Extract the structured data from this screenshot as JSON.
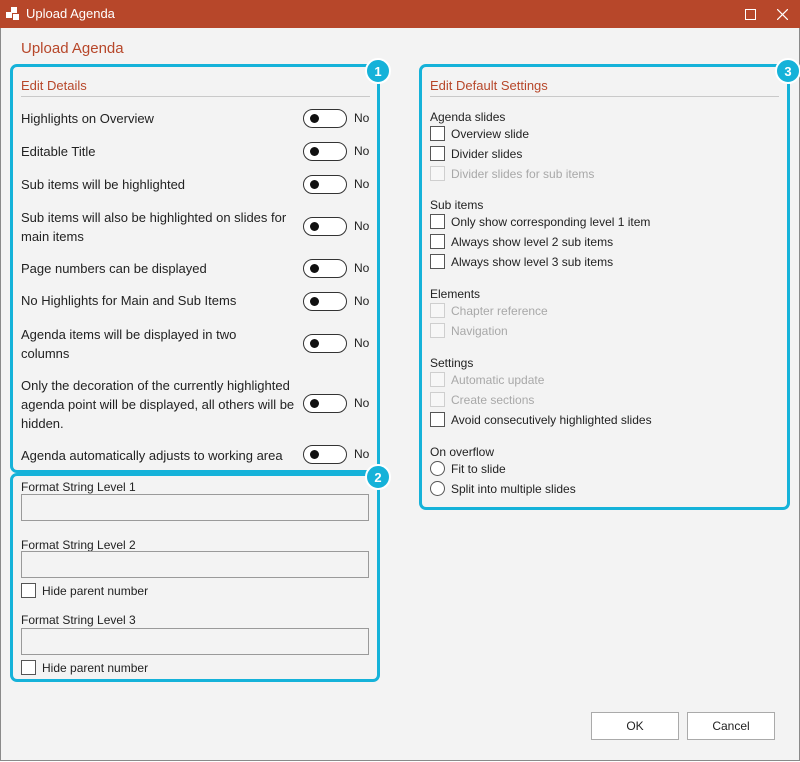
{
  "window": {
    "title": "Upload Agenda"
  },
  "dialog_title": "Upload Agenda",
  "badges": [
    "1",
    "2",
    "3"
  ],
  "colors": {
    "accent": "#b7472a",
    "highlight": "#15b2d9"
  },
  "edit_details": {
    "heading": "Edit Details",
    "toggles": [
      {
        "label": "Highlights on Overview",
        "state": "No"
      },
      {
        "label": "Editable Title",
        "state": "No"
      },
      {
        "label": "Sub items will be highlighted",
        "state": "No"
      },
      {
        "label": "Sub items will also be highlighted on slides for main items",
        "state": "No"
      },
      {
        "label": "Page numbers can be displayed",
        "state": "No"
      },
      {
        "label": "No Highlights for Main and Sub Items",
        "state": "No"
      },
      {
        "label": "Agenda items will be displayed in two columns",
        "state": "No"
      },
      {
        "label": "Only the decoration of the currently highlighted agenda point will be displayed, all others will be hidden.",
        "state": "No"
      },
      {
        "label": "Agenda automatically adjusts to working area",
        "state": "No"
      }
    ]
  },
  "format_strings": {
    "level1_label": "Format String Level 1",
    "level1_value": "",
    "level2_label": "Format String Level 2",
    "level2_value": "",
    "level2_hide_parent": "Hide parent number",
    "level3_label": "Format String Level 3",
    "level3_value": "",
    "level3_hide_parent": "Hide parent number"
  },
  "default_settings": {
    "heading": "Edit Default Settings",
    "agenda_slides": {
      "label": "Agenda slides",
      "items": [
        "Overview slide",
        "Divider slides",
        "Divider slides for sub items"
      ]
    },
    "sub_items": {
      "label": "Sub items",
      "items": [
        "Only show corresponding level 1 item",
        "Always show level 2 sub items",
        "Always show level 3 sub items"
      ]
    },
    "elements": {
      "label": "Elements",
      "items": [
        "Chapter reference",
        "Navigation"
      ]
    },
    "settings": {
      "label": "Settings",
      "items": [
        "Automatic update",
        "Create sections",
        "Avoid consecutively highlighted slides"
      ]
    },
    "on_overflow": {
      "label": "On overflow",
      "options": [
        "Fit to slide",
        "Split into multiple slides"
      ]
    }
  },
  "buttons": {
    "ok": "OK",
    "cancel": "Cancel"
  }
}
